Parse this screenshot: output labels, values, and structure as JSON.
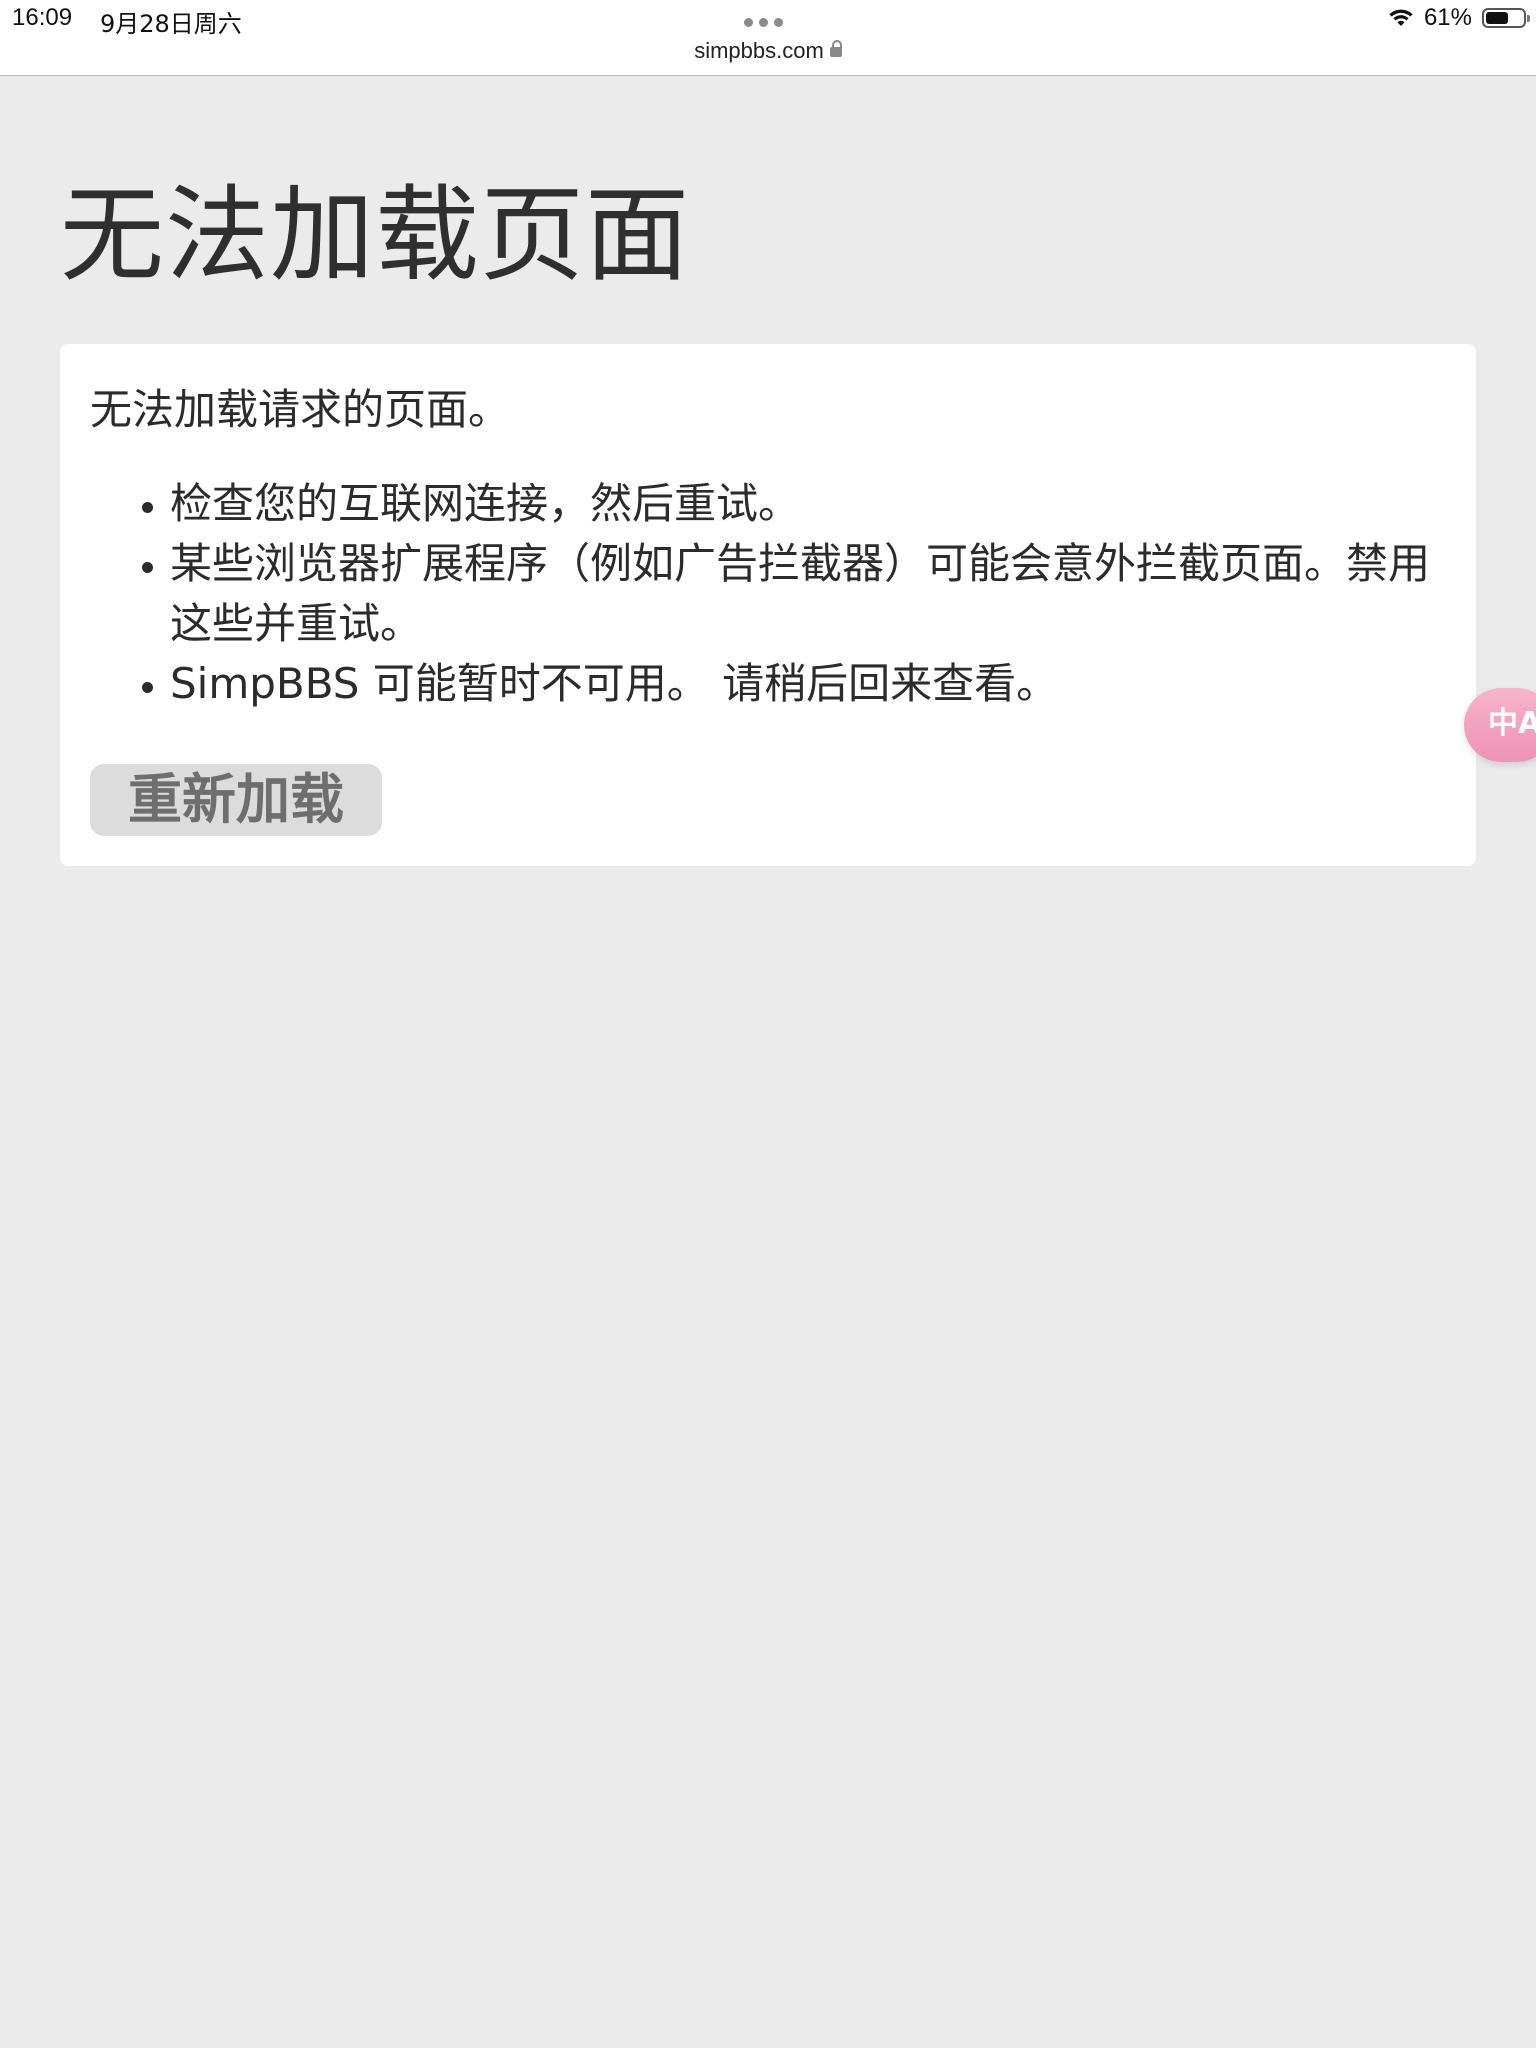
{
  "status_bar": {
    "time": "16:09",
    "date": "9月28日周六",
    "url": "simpbbs.com",
    "battery_percent": "61%",
    "battery_level": 0.61
  },
  "page": {
    "title": "无法加载页面",
    "intro": "无法加载请求的页面。",
    "tips": [
      "检查您的互联网连接，然后重试。",
      "某些浏览器扩展程序（例如广告拦截器）可能会意外拦截页面。禁用这些并重试。",
      "SimpBBS 可能暂时不可用。 请稍后回来查看。"
    ],
    "reload_label": "重新加载"
  },
  "floating": {
    "translate_icon": "translate-icon"
  },
  "colors": {
    "background": "#ebebeb",
    "card": "#ffffff",
    "button": "#dcdcdc",
    "button_text": "#6e6e6e",
    "translate_accent": "#f2a3bf"
  }
}
